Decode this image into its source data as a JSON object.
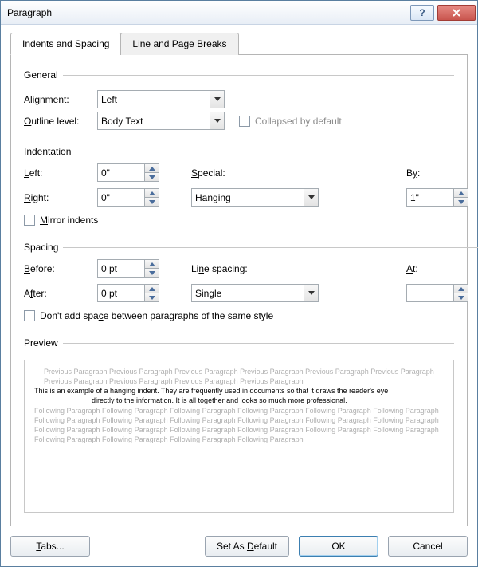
{
  "window": {
    "title": "Paragraph"
  },
  "tabs": {
    "indents": "Indents and Spacing",
    "pagebreaks": "Line and Page Breaks"
  },
  "general": {
    "legend": "General",
    "alignment_label": "Alignment:",
    "alignment_value": "Left",
    "outline_label": "Outline level:",
    "outline_value": "Body Text",
    "collapsed_label": "Collapsed by default"
  },
  "indent": {
    "legend": "Indentation",
    "left_label": "Left:",
    "left_value": "0\"",
    "right_label": "Right:",
    "right_value": "0\"",
    "special_label": "Special:",
    "special_value": "Hanging",
    "by_label": "By:",
    "by_value": "1\"",
    "mirror_label": "Mirror indents"
  },
  "spacing": {
    "legend": "Spacing",
    "before_label": "Before:",
    "before_value": "0 pt",
    "after_label": "After:",
    "after_value": "0 pt",
    "line_label": "Line spacing:",
    "line_value": "Single",
    "at_label": "At:",
    "at_value": "",
    "nospace_label": "Don't add space between paragraphs of the same style"
  },
  "preview": {
    "legend": "Preview",
    "prev_text": "Previous Paragraph Previous Paragraph Previous Paragraph Previous Paragraph Previous Paragraph Previous Paragraph Previous Paragraph Previous Paragraph Previous Paragraph Previous Paragraph",
    "body_line1": "This is an example of a hanging indent.  They are frequently used in documents so that it draws the reader's eye",
    "body_line2": "directly to the information.  It is all together and looks so much more professional.",
    "follow_text": "Following Paragraph Following Paragraph Following Paragraph Following Paragraph Following Paragraph Following Paragraph Following Paragraph Following Paragraph Following Paragraph Following Paragraph Following Paragraph Following Paragraph Following Paragraph Following Paragraph Following Paragraph Following Paragraph Following Paragraph Following Paragraph Following Paragraph Following Paragraph Following Paragraph Following Paragraph"
  },
  "footer": {
    "tabs": "Tabs...",
    "setdefault": "Set As Default",
    "ok": "OK",
    "cancel": "Cancel"
  }
}
